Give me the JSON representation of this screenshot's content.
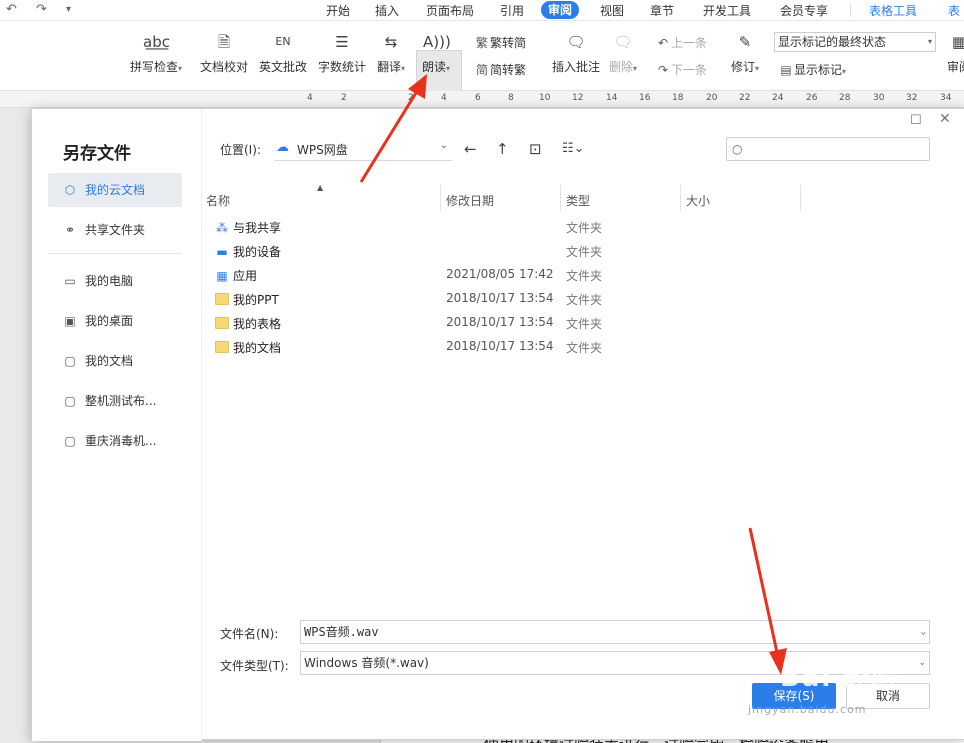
{
  "menubar": {
    "quick_access": [
      "↶",
      "↷",
      "▾"
    ],
    "tabs": [
      "开始",
      "插入",
      "页面布局",
      "引用",
      "审阅",
      "视图",
      "章节",
      "开发工具",
      "会员专享",
      "表格工具",
      "表"
    ],
    "active_tab": "审阅"
  },
  "ribbon": {
    "spell_check": "拼写检查",
    "doc_proof": "文档校对",
    "en_correct": "英文批改",
    "word_count": "字数统计",
    "translate": "翻译",
    "read_aloud": "朗读",
    "trad_to_simp": "繁转简",
    "simp_to_trad": "简转繁",
    "insert_comment": "插入批注",
    "delete": "删除",
    "prev": "上一条",
    "next": "下一条",
    "revise": "修订",
    "track_state": "显示标记的最终状态",
    "show_markup": "显示标记",
    "review": "审阅"
  },
  "ruler_labels": [
    "4",
    "2",
    "2",
    "4",
    "6",
    "8",
    "10",
    "12",
    "14",
    "16",
    "18",
    "20",
    "22",
    "24",
    "26",
    "28",
    "30",
    "32",
    "34"
  ],
  "dialog": {
    "title": "另存文件",
    "location_label": "位置(I):",
    "location_value": "WPS网盘",
    "sidebar": [
      {
        "icon": "⬡",
        "label": "我的云文档",
        "icon_name": "cloud-doc-icon"
      },
      {
        "icon": "⚭",
        "label": "共享文件夹",
        "icon_name": "shared-folder-icon"
      },
      {
        "icon": "▭",
        "label": "我的电脑",
        "icon_name": "computer-icon"
      },
      {
        "icon": "▣",
        "label": "我的桌面",
        "icon_name": "desktop-icon"
      },
      {
        "icon": "▢",
        "label": "我的文档",
        "icon_name": "documents-icon"
      },
      {
        "icon": "▢",
        "label": "整机测试布...",
        "icon_name": "folder-icon"
      },
      {
        "icon": "▢",
        "label": "重庆消毒机...",
        "icon_name": "folder-icon"
      }
    ],
    "columns": {
      "name": "名称",
      "modified": "修改日期",
      "type": "类型",
      "size": "大小"
    },
    "files": [
      {
        "name": "与我共享",
        "date": "",
        "type": "文件夹",
        "icon": "share"
      },
      {
        "name": "我的设备",
        "date": "",
        "type": "文件夹",
        "icon": "device"
      },
      {
        "name": "应用",
        "date": "2021/08/05 17:42",
        "type": "文件夹",
        "icon": "apps"
      },
      {
        "name": "我的PPT",
        "date": "2018/10/17 13:54",
        "type": "文件夹",
        "icon": "folder"
      },
      {
        "name": "我的表格",
        "date": "2018/10/17 13:54",
        "type": "文件夹",
        "icon": "folder"
      },
      {
        "name": "我的文档",
        "date": "2018/10/17 13:54",
        "type": "文件夹",
        "icon": "folder"
      }
    ],
    "filename_label": "文件名(N):",
    "filename_value": "WPS音频.wav",
    "filetype_label": "文件类型(T):",
    "filetype_value": "Windows 音频(*.wav)",
    "save_label": "保存(S)",
    "cancel_label": "取消"
  },
  "doc_text": "使用的环境试验装置进行，试验完毕，检验设备服用",
  "watermark": {
    "text": "Bai 经验",
    "url": "jingyan.baidu.com"
  },
  "colors": {
    "accent": "#2b7de9",
    "arrow": "#e8321e"
  }
}
